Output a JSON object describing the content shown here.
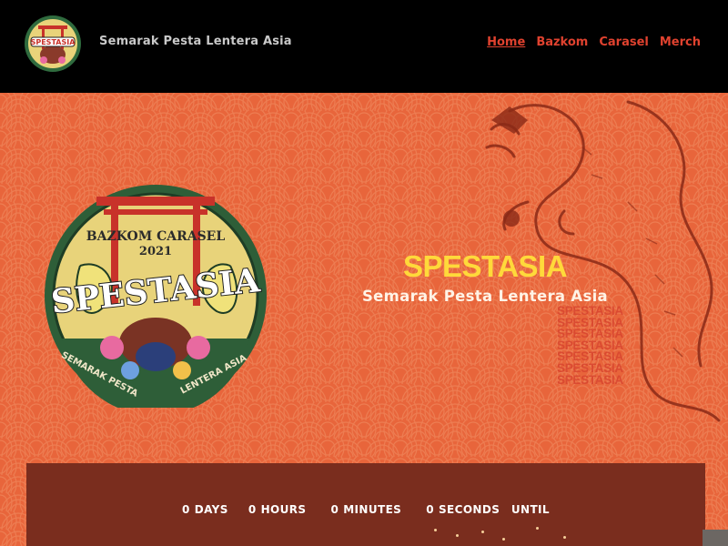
{
  "header": {
    "site_title": "Semarak Pesta Lentera Asia",
    "nav": [
      {
        "label": "Home",
        "active": true
      },
      {
        "label": "Bazkom",
        "active": false
      },
      {
        "label": "Carasel",
        "active": false
      },
      {
        "label": "Merch",
        "active": false
      }
    ]
  },
  "hero": {
    "title": "SPESTASIA",
    "subtitle": "Semarak Pesta Lentera Asia",
    "echo_text": "SPESTASIA",
    "badge": {
      "top_text": "BAZKOM CARASEL",
      "year": "2021",
      "name": "SPESTASIA",
      "bottom_left": "SEMARAK PESTA",
      "bottom_right": "LENTERA ASIA"
    }
  },
  "countdown": {
    "days_value": "0",
    "days_label": "DAYS",
    "hours_value": "0",
    "hours_label": "HOURS",
    "minutes_value": "0",
    "minutes_label": "MINUTES",
    "seconds_value": "0",
    "seconds_label": "SECONDS",
    "suffix": "UNTIL"
  },
  "colors": {
    "accent": "#e0422f",
    "title_yellow": "#ffd93a",
    "hero_orange": "#ea6a3f",
    "panel": "#7a2d1e"
  },
  "icons": [
    "spestasia-logo",
    "dragon-illustration",
    "spestasia-badge"
  ]
}
